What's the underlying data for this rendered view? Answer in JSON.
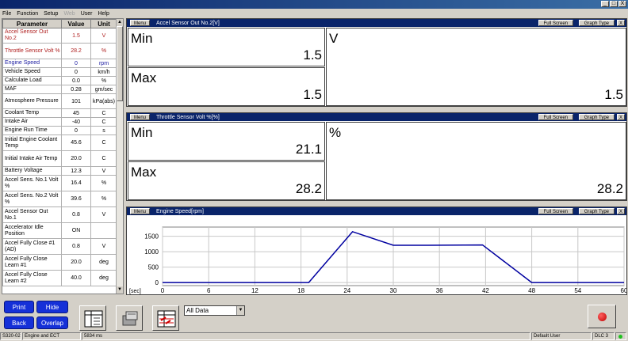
{
  "window": {
    "minimize": "_",
    "maximize": "□",
    "close": "X"
  },
  "menu": [
    "File",
    "Function",
    "Setup",
    "Web",
    "User",
    "Help"
  ],
  "table": {
    "headers": {
      "param": "Parameter",
      "value": "Value",
      "unit": "Unit"
    },
    "rows": [
      {
        "name": "Accel Sensor Out No.2",
        "value": "1.5",
        "unit": "V",
        "style": "red"
      },
      {
        "name": "Throttle Sensor Volt %",
        "value": "28.2",
        "unit": "%",
        "style": "red"
      },
      {
        "name": "Engine Speed",
        "value": "0",
        "unit": "rpm",
        "style": "blue"
      },
      {
        "name": "Vehicle Speed",
        "value": "0",
        "unit": "km/h",
        "style": ""
      },
      {
        "name": "Calculate Load",
        "value": "0.0",
        "unit": "%",
        "style": ""
      },
      {
        "name": "MAF",
        "value": "0.28",
        "unit": "gm/sec",
        "style": ""
      },
      {
        "name": "Atmosphere Pressure",
        "value": "101",
        "unit": "kPa(abs)",
        "style": ""
      },
      {
        "name": "Coolant Temp",
        "value": "45",
        "unit": "C",
        "style": ""
      },
      {
        "name": "Intake Air",
        "value": "-40",
        "unit": "C",
        "style": ""
      },
      {
        "name": "Engine Run Time",
        "value": "0",
        "unit": "s",
        "style": ""
      },
      {
        "name": "Initial Engine Coolant Temp",
        "value": "45.6",
        "unit": "C",
        "style": ""
      },
      {
        "name": "Initial Intake Air Temp",
        "value": "20.0",
        "unit": "C",
        "style": ""
      },
      {
        "name": "Battery Voltage",
        "value": "12.3",
        "unit": "V",
        "style": ""
      },
      {
        "name": "Accel Sens. No.1 Volt %",
        "value": "16.4",
        "unit": "%",
        "style": ""
      },
      {
        "name": "Accel Sens. No.2 Volt %",
        "value": "39.6",
        "unit": "%",
        "style": ""
      },
      {
        "name": "Accel Sensor Out No.1",
        "value": "0.8",
        "unit": "V",
        "style": ""
      },
      {
        "name": "Accelerator Idle Position",
        "value": "ON",
        "unit": "",
        "style": ""
      },
      {
        "name": "Accel Fully Close #1 (AD)",
        "value": "0.8",
        "unit": "V",
        "style": ""
      },
      {
        "name": "Accel Fully Close Learn #1",
        "value": "20.0",
        "unit": "deg",
        "style": ""
      },
      {
        "name": "Accel Fully Close Learn #2",
        "value": "40.0",
        "unit": "deg",
        "style": ""
      }
    ]
  },
  "panels": [
    {
      "menu": "Menu",
      "title": "Accel Sensor Out No.2[V]",
      "full": "Full Screen",
      "type": "Graph Type",
      "close": "X",
      "min_label": "Min",
      "min_value": "1.5",
      "max_label": "Max",
      "max_value": "1.5",
      "unit": "V",
      "current": "1.5"
    },
    {
      "menu": "Menu",
      "title": "Throttle Sensor Volt %[%]",
      "full": "Full Screen",
      "type": "Graph Type",
      "close": "X",
      "min_label": "Min",
      "min_value": "21.1",
      "max_label": "Max",
      "max_value": "28.2",
      "unit": "%",
      "current": "28.2"
    }
  ],
  "engine_panel": {
    "menu": "Menu",
    "title": "Engine Speed[rpm]",
    "full": "Full Screen",
    "type": "Graph Type",
    "close": "X"
  },
  "chart_data": {
    "type": "line",
    "title": "Engine Speed[rpm]",
    "x_unit_label": "[sec]",
    "x_ticks": [
      0,
      6,
      12,
      18,
      24,
      30,
      36,
      42,
      48,
      54,
      60
    ],
    "y_ticks": [
      0,
      500,
      1000,
      1500
    ],
    "xlim": [
      0,
      60
    ],
    "ylim": [
      -100,
      1800
    ],
    "grid": true,
    "color": "#0000a0",
    "series": [
      {
        "x": [
          0,
          19,
          24.7,
          30,
          34.5,
          41.6,
          48,
          60
        ],
        "y": [
          0,
          0,
          1650,
          1210,
          1210,
          1220,
          0,
          0
        ]
      }
    ]
  },
  "controls": {
    "print": "Print",
    "hide": "Hide",
    "back": "Back",
    "overlap": "Overlap",
    "dropdown": "All Data",
    "dropdown_arrow": "▼"
  },
  "statusbar": {
    "code": "S320-02",
    "system": "Engine and ECT",
    "time": "5834 ms",
    "user": "Default User",
    "dlc": "DLC 3"
  },
  "colors": {
    "accent": "#0a246a",
    "button_blue": "#1530d8",
    "line": "#0000a0",
    "param_red": "#b02020",
    "param_blue": "#1a1aa0"
  }
}
